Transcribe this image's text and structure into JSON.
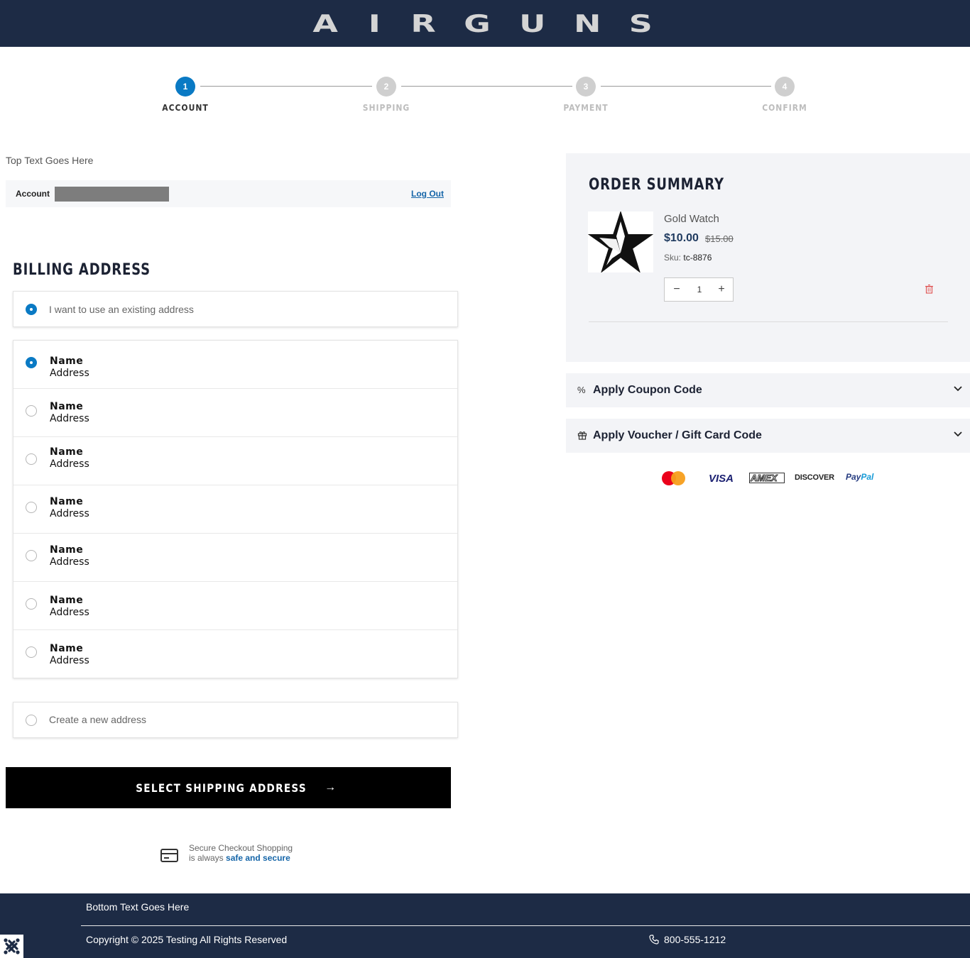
{
  "header": {
    "logo_letters": [
      "A",
      "I",
      "R",
      "G",
      "U",
      "N",
      "S"
    ]
  },
  "steps": [
    {
      "number": "1",
      "label": "ACCOUNT",
      "active": true
    },
    {
      "number": "2",
      "label": "SHIPPING",
      "active": false
    },
    {
      "number": "3",
      "label": "PAYMENT",
      "active": false
    },
    {
      "number": "4",
      "label": "CONFIRM",
      "active": false
    }
  ],
  "top_text": "Top Text Goes Here",
  "account": {
    "label": "Account",
    "logout_label": "Log Out"
  },
  "billing": {
    "title": "BILLING ADDRESS",
    "existing_option": "I want to use an existing address",
    "new_option": "Create a new address",
    "addresses": [
      {
        "name": "Name",
        "address": "Address",
        "selected": true
      },
      {
        "name": "Name",
        "address": "Address",
        "selected": false
      },
      {
        "name": "Name",
        "address": "Address",
        "selected": false
      },
      {
        "name": "Name",
        "address": "Address",
        "selected": false
      },
      {
        "name": "Name",
        "address": "Address",
        "selected": false
      },
      {
        "name": "Name",
        "address": "Address",
        "selected": false
      },
      {
        "name": "Name",
        "address": "Address",
        "selected": false
      }
    ]
  },
  "cta": {
    "label": "SELECT SHIPPING ADDRESS",
    "arrow": "→"
  },
  "secure": {
    "line1": "Secure Checkout Shopping",
    "line2_prefix": "is always",
    "line2_strong": "safe and secure"
  },
  "order_summary": {
    "title": "ORDER SUMMARY",
    "product": {
      "name": "Gold Watch",
      "price": "$10.00",
      "old_price": "$15.00",
      "sku_label": "Sku:",
      "sku": "tc-8876",
      "quantity": "1",
      "image_icon": "star-icon"
    }
  },
  "accordions": [
    {
      "icon": "percent-icon",
      "symbol": "%",
      "label": "Apply Coupon Code"
    },
    {
      "icon": "gift-icon",
      "symbol": "",
      "label": "Apply Voucher / Gift Card Code"
    }
  ],
  "payment_methods": {
    "visa": "VISA",
    "amex": "AMEX",
    "discover": "DISCOVER",
    "paypal_1": "Pay",
    "paypal_2": "Pal"
  },
  "footer": {
    "top_text": "Bottom Text Goes Here",
    "copyright": "Copyright © 2025 Testing All Rights Reserved",
    "phone": "800-555-1212"
  },
  "colors": {
    "navy": "#1d2b45",
    "accent": "#0a7ac4",
    "link": "#1565a8",
    "panel": "#f3f4f7"
  }
}
